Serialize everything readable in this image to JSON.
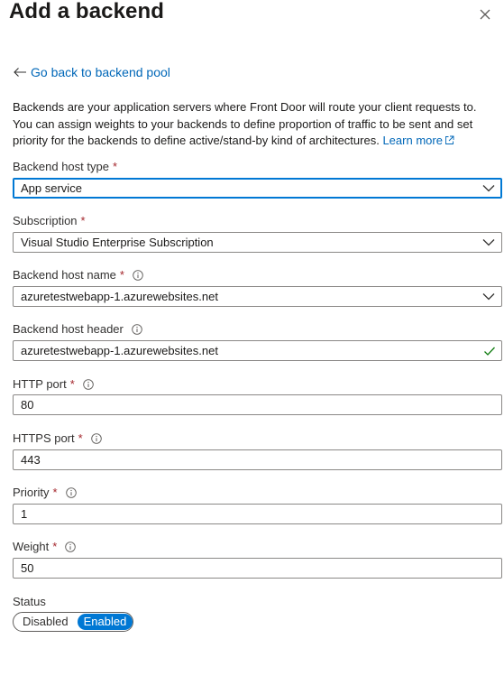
{
  "panel": {
    "title": "Add a backend",
    "back_link": "Go back to backend pool",
    "description": "Backends are your application servers where Front Door will route your client requests to. You can assign weights to your backends to define proportion of traffic to be sent and set priority for the backends to define active/stand-by kind of architectures.",
    "learn_more": "Learn more"
  },
  "fields": {
    "host_type": {
      "label": "Backend host type",
      "value": "App service"
    },
    "subscription": {
      "label": "Subscription",
      "value": "Visual Studio Enterprise Subscription"
    },
    "host_name": {
      "label": "Backend host name",
      "value": "azuretestwebapp-1.azurewebsites.net"
    },
    "host_header": {
      "label": "Backend host header",
      "value": "azuretestwebapp-1.azurewebsites.net"
    },
    "http_port": {
      "label": "HTTP port",
      "value": "80"
    },
    "https_port": {
      "label": "HTTPS port",
      "value": "443"
    },
    "priority": {
      "label": "Priority",
      "value": "1"
    },
    "weight": {
      "label": "Weight",
      "value": "50"
    }
  },
  "status": {
    "label": "Status",
    "options": [
      "Disabled",
      "Enabled"
    ],
    "selected": "Enabled"
  },
  "required_marker": "*",
  "colors": {
    "accent": "#0078d4",
    "link": "#0067b8",
    "required": "#a4262c",
    "valid_check": "#107c10"
  },
  "icons": {
    "close": "close-icon",
    "back": "arrow-left-icon",
    "external": "external-link-icon",
    "dropdown": "chevron-down-icon",
    "info": "info-icon",
    "valid": "checkmark-icon"
  }
}
